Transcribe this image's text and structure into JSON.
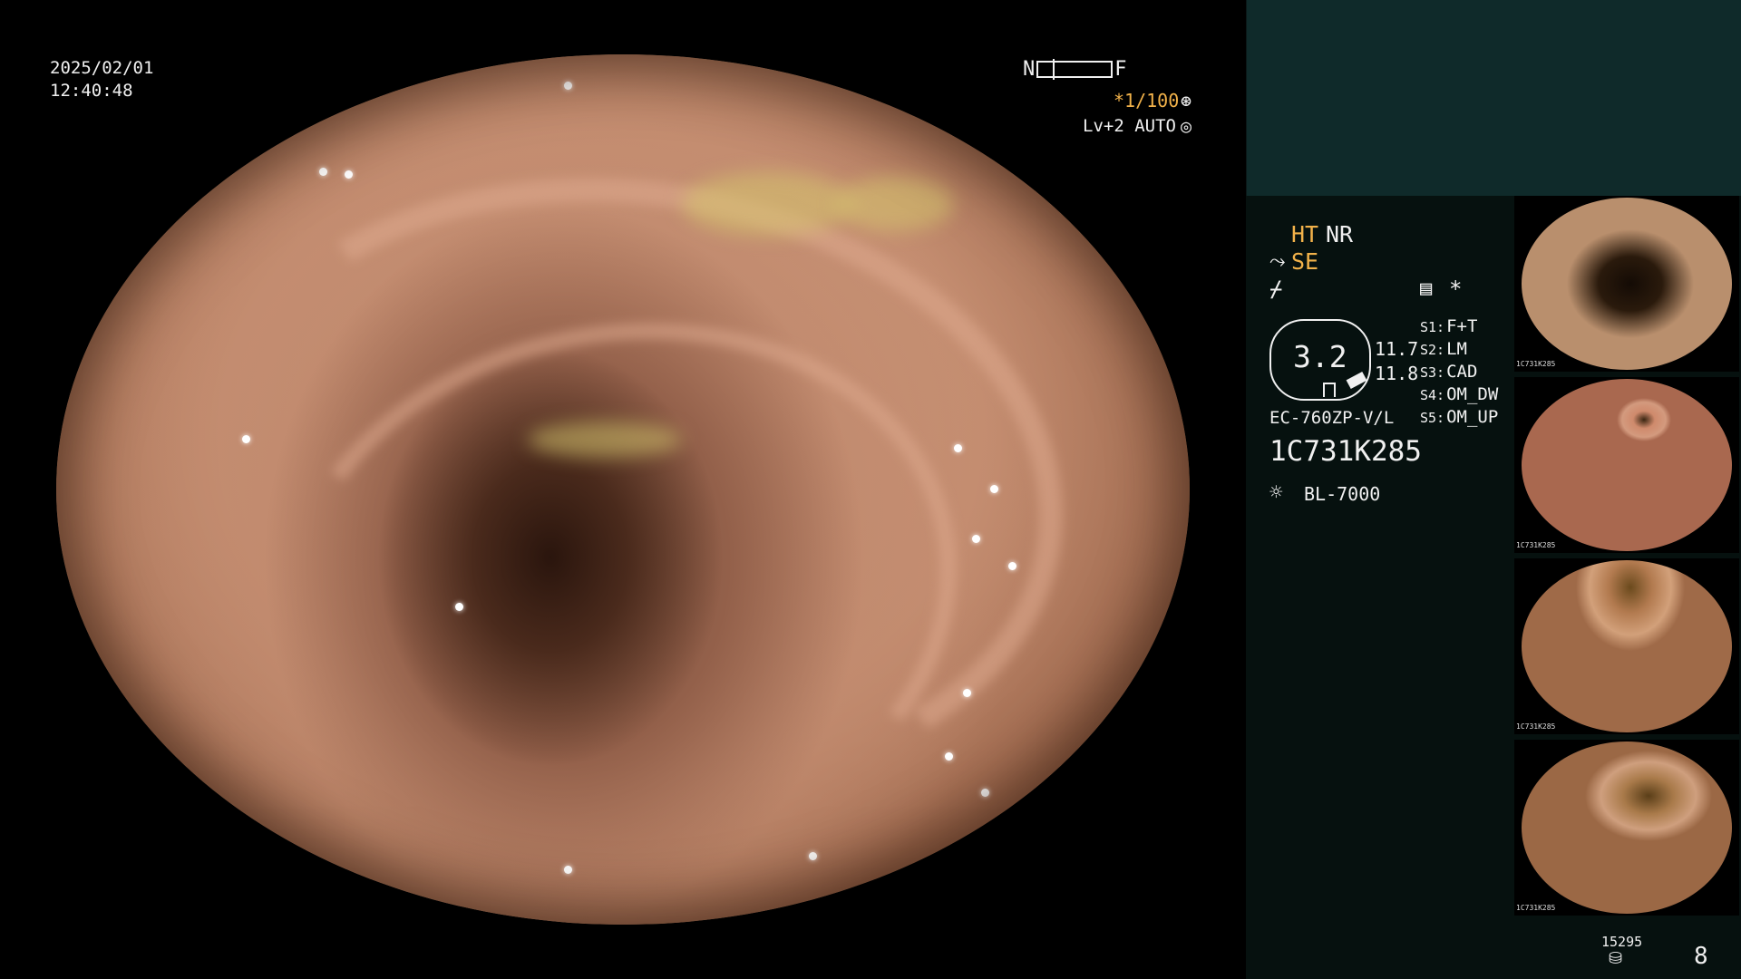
{
  "osd": {
    "date": "2025/02/01",
    "time": "12:40:48",
    "near_label": "N",
    "far_label": "F",
    "shutter": "*1/100",
    "level": "Lv+2 AUTO"
  },
  "icons": {
    "shutter": "shutter-icon",
    "level": "iris-icon",
    "structure": "structure-enhance-icon",
    "slash": "color-mode-icon",
    "memo": "memo-icon",
    "star": "star-icon",
    "light": "lamp-icon",
    "storage": "storage-icon"
  },
  "panel": {
    "ht": "HT",
    "nr": "NR",
    "se": "SE",
    "star": "*",
    "zoom_value": "3.2",
    "value_1": "11.7",
    "value_2": "11.8",
    "slots": [
      {
        "num": "S1:",
        "label": "F+T"
      },
      {
        "num": "S2:",
        "label": "LM"
      },
      {
        "num": "S3:",
        "label": "CAD"
      },
      {
        "num": "S4:",
        "label": "OM_DW"
      },
      {
        "num": "S5:",
        "label": "OM_UP"
      }
    ],
    "scope_model": "EC-760ZP-V/L",
    "serial": "1C731K285",
    "light_source": "BL-7000",
    "storage_count": "15295",
    "image_count": "8"
  },
  "colors": {
    "accent": "#f2b24a",
    "text": "#f0f0f0",
    "panel_top": "#0f2a2a",
    "panel_bg": "#06110f"
  },
  "thumbnails": [
    {
      "label": "1C731K285"
    },
    {
      "label": "1C731K285"
    },
    {
      "label": "1C731K285"
    },
    {
      "label": "1C731K285"
    }
  ]
}
